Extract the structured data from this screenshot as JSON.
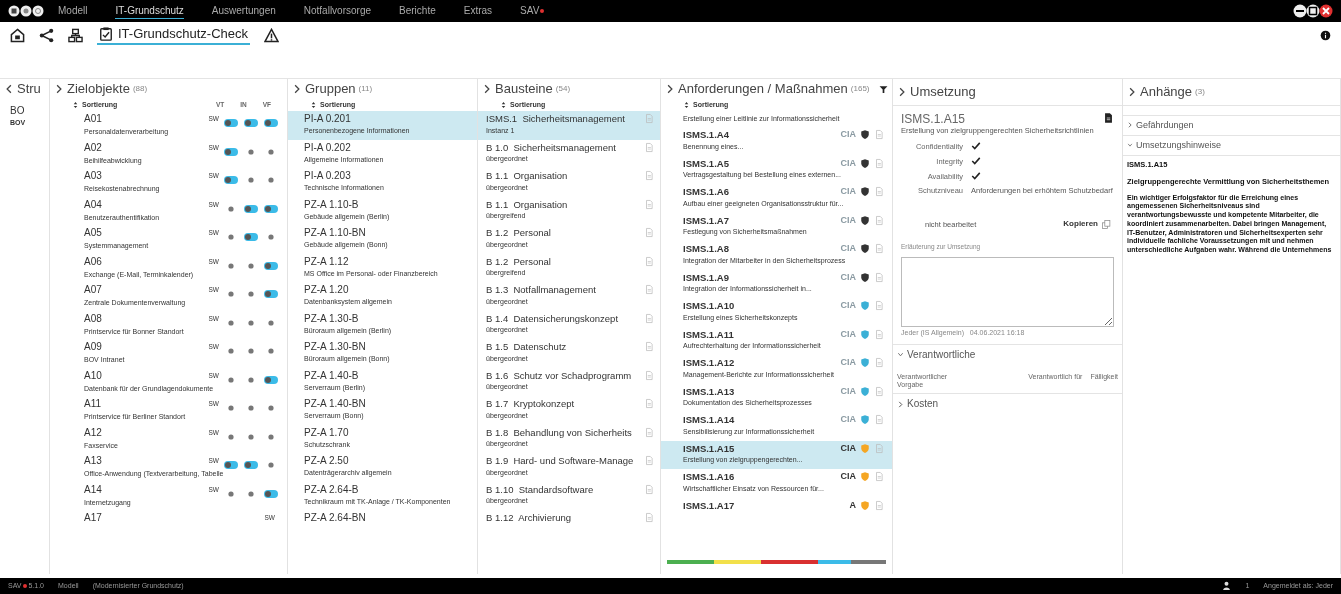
{
  "menu": [
    {
      "label": "Modell",
      "selected": false,
      "alert": false
    },
    {
      "label": "IT-Grundschutz",
      "selected": true,
      "alert": false
    },
    {
      "label": "Auswertungen",
      "selected": false,
      "alert": false
    },
    {
      "label": "Notfallvorsorge",
      "selected": false,
      "alert": false
    },
    {
      "label": "Berichte",
      "selected": false,
      "alert": false
    },
    {
      "label": "Extras",
      "selected": false,
      "alert": false
    },
    {
      "label": "SAV",
      "selected": false,
      "alert": true
    }
  ],
  "toolbar": {
    "tab": {
      "label": "IT-Grundschutz-Check",
      "selected": true
    }
  },
  "struktur": {
    "title": "Stru",
    "items": [
      {
        "title": "BO",
        "subtitle": "BOV"
      }
    ]
  },
  "zielobjekte": {
    "title": "Zielobjekte",
    "count": "(88)",
    "sort_label": "Sortierung",
    "rating_columns": [
      "VT",
      "IN",
      "VF"
    ],
    "items": [
      {
        "id": "A01",
        "name": "Personaldatenverarbeitung",
        "scale": "SW",
        "ratings": [
          {
            "set": true
          },
          {
            "set": true
          },
          {
            "set": true
          }
        ]
      },
      {
        "id": "A02",
        "name": "Beihilfeabwicklung",
        "scale": "SW",
        "ratings": [
          {
            "set": true
          },
          {
            "set": false
          },
          {
            "set": false
          }
        ]
      },
      {
        "id": "A03",
        "name": "Reisekostenabrechnung",
        "scale": "SW",
        "ratings": [
          {
            "set": true
          },
          {
            "set": false
          },
          {
            "set": false
          }
        ]
      },
      {
        "id": "A04",
        "name": "Benutzerauthentifikation",
        "scale": "SW",
        "ratings": [
          {
            "set": false
          },
          {
            "set": true
          },
          {
            "set": true
          }
        ]
      },
      {
        "id": "A05",
        "name": "Systemmanagement",
        "scale": "SW",
        "ratings": [
          {
            "set": false
          },
          {
            "set": true
          },
          {
            "set": false
          }
        ]
      },
      {
        "id": "A06",
        "name": "Exchange (E-Mail, Terminkalender)",
        "scale": "SW",
        "ratings": [
          {
            "set": false
          },
          {
            "set": false
          },
          {
            "set": true
          }
        ]
      },
      {
        "id": "A07",
        "name": "Zentrale Dokumentenverwaltung",
        "scale": "SW",
        "ratings": [
          {
            "set": false
          },
          {
            "set": false
          },
          {
            "set": true
          }
        ]
      },
      {
        "id": "A08",
        "name": "Printservice für Bonner Standort",
        "scale": "SW",
        "ratings": [
          {
            "set": false
          },
          {
            "set": false
          },
          {
            "set": false
          }
        ]
      },
      {
        "id": "A09",
        "name": "BOV Intranet",
        "scale": "SW",
        "ratings": [
          {
            "set": false
          },
          {
            "set": false
          },
          {
            "set": false
          }
        ]
      },
      {
        "id": "A10",
        "name": "Datenbank für der Grundlagendokumente",
        "scale": "SW",
        "ratings": [
          {
            "set": false
          },
          {
            "set": false
          },
          {
            "set": true
          }
        ]
      },
      {
        "id": "A11",
        "name": "Printservice für Berliner Standort",
        "scale": "SW",
        "ratings": [
          {
            "set": false
          },
          {
            "set": false
          },
          {
            "set": false
          }
        ]
      },
      {
        "id": "A12",
        "name": "Faxservice",
        "scale": "SW",
        "ratings": [
          {
            "set": false
          },
          {
            "set": false
          },
          {
            "set": false
          }
        ]
      },
      {
        "id": "A13",
        "name": "Office-Anwendung (Textverarbeitung, Tabelle",
        "scale": "SW",
        "ratings": [
          {
            "set": true
          },
          {
            "set": true
          },
          {
            "set": false
          }
        ]
      },
      {
        "id": "A14",
        "name": "Internetzugang",
        "scale": "SW",
        "ratings": [
          {
            "set": false
          },
          {
            "set": false
          },
          {
            "set": true
          }
        ]
      },
      {
        "id": "A17",
        "scale": "SW"
      }
    ]
  },
  "gruppen": {
    "title": "Gruppen",
    "count": "(11)",
    "sort_label": "Sortierung",
    "items": [
      {
        "id": "PI-A 0.201",
        "name": "Personenbezogene Informationen",
        "selected": true
      },
      {
        "id": "PI-A 0.202",
        "name": "Allgemeine Informationen",
        "selected": false
      },
      {
        "id": "PI-A 0.203",
        "name": "Technische Informationen",
        "selected": false
      },
      {
        "id": "PZ-A 1.10-B",
        "name": "Gebäude allgemein (Berlin)",
        "selected": false
      },
      {
        "id": "PZ-A 1.10-BN",
        "name": "Gebäude allgemein (Bonn)",
        "selected": false
      },
      {
        "id": "PZ-A 1.12",
        "name": "MS Office im Personal- oder Finanzbereich",
        "selected": false
      },
      {
        "id": "PZ-A 1.20",
        "name": "Datenbanksystem allgemein",
        "selected": false
      },
      {
        "id": "PZ-A 1.30-B",
        "name": "Büroraum allgemein (Berlin)",
        "selected": false
      },
      {
        "id": "PZ-A 1.30-BN",
        "name": "Büroraum allgemein (Bonn)",
        "selected": false
      },
      {
        "id": "PZ-A 1.40-B",
        "name": "Serverraum (Berlin)",
        "selected": false
      },
      {
        "id": "PZ-A 1.40-BN",
        "name": "Serverraum (Bonn)",
        "selected": false
      },
      {
        "id": "PZ-A 1.70",
        "name": "Schutzschrank",
        "selected": false
      },
      {
        "id": "PZ-A 2.50",
        "name": "Datenträgerarchiv allgemein",
        "selected": false
      },
      {
        "id": "PZ-A 2.64-B",
        "name": "Technikraum mit TK-Anlage / TK-Komponenten",
        "selected": false
      },
      {
        "id": "PZ-A 2.64-BN",
        "selected": false
      }
    ]
  },
  "bausteine": {
    "title": "Bausteine",
    "count": "(54)",
    "sort_label": "Sortierung",
    "items": [
      {
        "id": "ISMS.1",
        "name": "Sicherheitsmanagement",
        "sub": "Instanz 1",
        "selected": true
      },
      {
        "id": "B 1.0",
        "name": "Sicherheitsmanagement",
        "sub": "übergeordnet",
        "selected": false
      },
      {
        "id": "B 1.1",
        "name": "Organisation",
        "sub": "übergeordnet",
        "selected": false
      },
      {
        "id": "B 1.1",
        "name": "Organisation",
        "sub": "übergreifend",
        "selected": false
      },
      {
        "id": "B 1.2",
        "name": "Personal",
        "sub": "übergeordnet",
        "selected": false
      },
      {
        "id": "B 1.2",
        "name": "Personal",
        "sub": "übergreifend",
        "selected": false
      },
      {
        "id": "B 1.3",
        "name": "Notfallmanagement",
        "sub": "übergeordnet",
        "selected": false
      },
      {
        "id": "B 1.4",
        "name": "Datensicherungskonzept",
        "sub": "übergeordnet",
        "selected": false
      },
      {
        "id": "B 1.5",
        "name": "Datenschutz",
        "sub": "übergeordnet",
        "selected": false
      },
      {
        "id": "B 1.6",
        "name": "Schutz vor Schadprogramm",
        "sub": "übergeordnet",
        "selected": false
      },
      {
        "id": "B 1.7",
        "name": "Kryptokonzept",
        "sub": "übergeordnet",
        "selected": false
      },
      {
        "id": "B 1.8",
        "name": "Behandlung von Sicherheits",
        "sub": "übergeordnet",
        "selected": false
      },
      {
        "id": "B 1.9",
        "name": "Hard- und Software-Manage",
        "sub": "übergeordnet",
        "selected": false
      },
      {
        "id": "B 1.10",
        "name": "Standardsoftware",
        "sub": "übergeordnet",
        "selected": false
      },
      {
        "id": "B 1.12",
        "name": "Archivierung",
        "selected": false
      }
    ]
  },
  "anforderungen": {
    "title": "Anforderungen / Maßnahmen",
    "count": "(165)",
    "sort_label": "Sortierung",
    "items": [
      {
        "name": "Erstellung einer Leitlinie zur Informationssicherheit",
        "selected": false
      },
      {
        "id": "ISMS.1.A4",
        "name": "Benennung eines...",
        "cia": "CIA",
        "cia_active": false,
        "color": "#333333",
        "selected": false
      },
      {
        "id": "ISMS.1.A5",
        "name": "Vertragsgestaltung bei Bestellung eines externen...",
        "cia": "CIA",
        "cia_active": false,
        "color": "#333333",
        "selected": false
      },
      {
        "id": "ISMS.1.A6",
        "name": "Aufbau einer geeigneten Organisationsstruktur für...",
        "cia": "CIA",
        "cia_active": false,
        "color": "#333333",
        "selected": false
      },
      {
        "id": "ISMS.1.A7",
        "name": "Festlegung von Sicherheitsmaßnahmen",
        "cia": "CIA",
        "cia_active": false,
        "color": "#333333",
        "selected": false
      },
      {
        "id": "ISMS.1.A8",
        "name": "Integration der Mitarbeiter in den Sicherheitsprozess",
        "cia": "CIA",
        "cia_active": false,
        "color": "#333333",
        "selected": false
      },
      {
        "id": "ISMS.1.A9",
        "name": "Integration der Informationssicherheit in...",
        "cia": "CIA",
        "cia_active": false,
        "color": "#333333",
        "selected": false
      },
      {
        "id": "ISMS.1.A10",
        "name": "Erstellung eines Sicherheitskonzepts",
        "cia": "CIA",
        "cia_active": false,
        "color": "#3bb0d6",
        "selected": false
      },
      {
        "id": "ISMS.1.A11",
        "name": "Aufrechterhaltung der Informationssicherheit",
        "cia": "CIA",
        "cia_active": false,
        "color": "#3bb0d6",
        "selected": false
      },
      {
        "id": "ISMS.1.A12",
        "name": "Management-Berichte zur Informationssicherheit",
        "cia": "CIA",
        "cia_active": false,
        "color": "#3bb0d6",
        "selected": false
      },
      {
        "id": "ISMS.1.A13",
        "name": "Dokumentation des Sicherheitsprozesses",
        "cia": "CIA",
        "cia_active": false,
        "color": "#3bb0d6",
        "selected": false
      },
      {
        "id": "ISMS.1.A14",
        "name": "Sensibilisierung zur Informationssicherheit",
        "cia": "CIA",
        "cia_active": false,
        "color": "#3bb0d6",
        "selected": false
      },
      {
        "id": "ISMS.1.A15",
        "name": "Erstellung von zielgruppengerechten...",
        "cia": "CIA",
        "cia_active": true,
        "color": "#f5a623",
        "selected": true
      },
      {
        "id": "ISMS.1.A16",
        "name": "Wirtschaftlicher Einsatz von Ressourcen für...",
        "cia": "CIA",
        "cia_active": true,
        "color": "#f5a623",
        "selected": false
      },
      {
        "id": "ISMS.1.A17",
        "cia": "A",
        "cia_active": true,
        "color": "#f5a623",
        "selected": false
      }
    ],
    "status_segments": [
      {
        "color": "#4caf50"
      },
      {
        "color": "#f2e04a"
      },
      {
        "color": "#d93030"
      },
      {
        "color": "#3bbbe8"
      },
      {
        "color": "#777777"
      }
    ]
  },
  "umsetzung": {
    "title": "Umsetzung",
    "id": "ISMS.1.A15",
    "description": "Erstellung von zielgruppengerechten Sicherheitsrichtlinien",
    "objectives": [
      {
        "label": "Confidentiality",
        "checked": true
      },
      {
        "label": "Integrity",
        "checked": true
      },
      {
        "label": "Availability",
        "checked": true
      }
    ],
    "level_label": "Schutzniveau",
    "level_value": "Anforderungen bei erhöhtem Schutzbedarf",
    "status": "nicht bearbeitet",
    "copy_button": "Kopieren",
    "notes_label": "Erläuterung zur Umsetzung",
    "notes_meta": "Jeder (IS Allgemein)   04.06.2021 16:18",
    "sections": [
      {
        "title": "Verantwortliche",
        "expanded": true,
        "fields": [
          "Verantwortlicher",
          "Vorgabe"
        ],
        "right_fields": [
          "Verantwortlich für",
          "Fälligkeit"
        ]
      },
      {
        "title": "Kosten",
        "expanded": false
      }
    ]
  },
  "anhaenge": {
    "title": "Anhänge",
    "count": "(3)",
    "sections": [
      {
        "title": "Gefährdungen",
        "expanded": false
      },
      {
        "title": "Umsetzungshinweise",
        "expanded": true,
        "id": "ISMS.1.A15",
        "heading": "Zielgruppengerechte Vermittlung von Sicherheitsthemen",
        "text": "Ein wichtiger Erfolgsfaktor für die Erreichung eines angemessenen Sicherheitsniveaus sind verantwortungsbewusste und kompetente Mitarbeiter, die koordiniert zusammenarbeiten. Dabei bringen Management, IT-Benutzer, Administratoren und Sicherheitsexperten sehr individuelle fachliche Voraussetzungen mit und nehmen unterschiedliche Aufgaben wahr. Während die Unternehmens"
      }
    ]
  },
  "status_bar": {
    "app": "SAV",
    "version": "5.1.0",
    "module": "Modell",
    "model": "(Modernisierter Grundschutz)",
    "users": "1",
    "login": "Angemeldet als: Jeder"
  }
}
